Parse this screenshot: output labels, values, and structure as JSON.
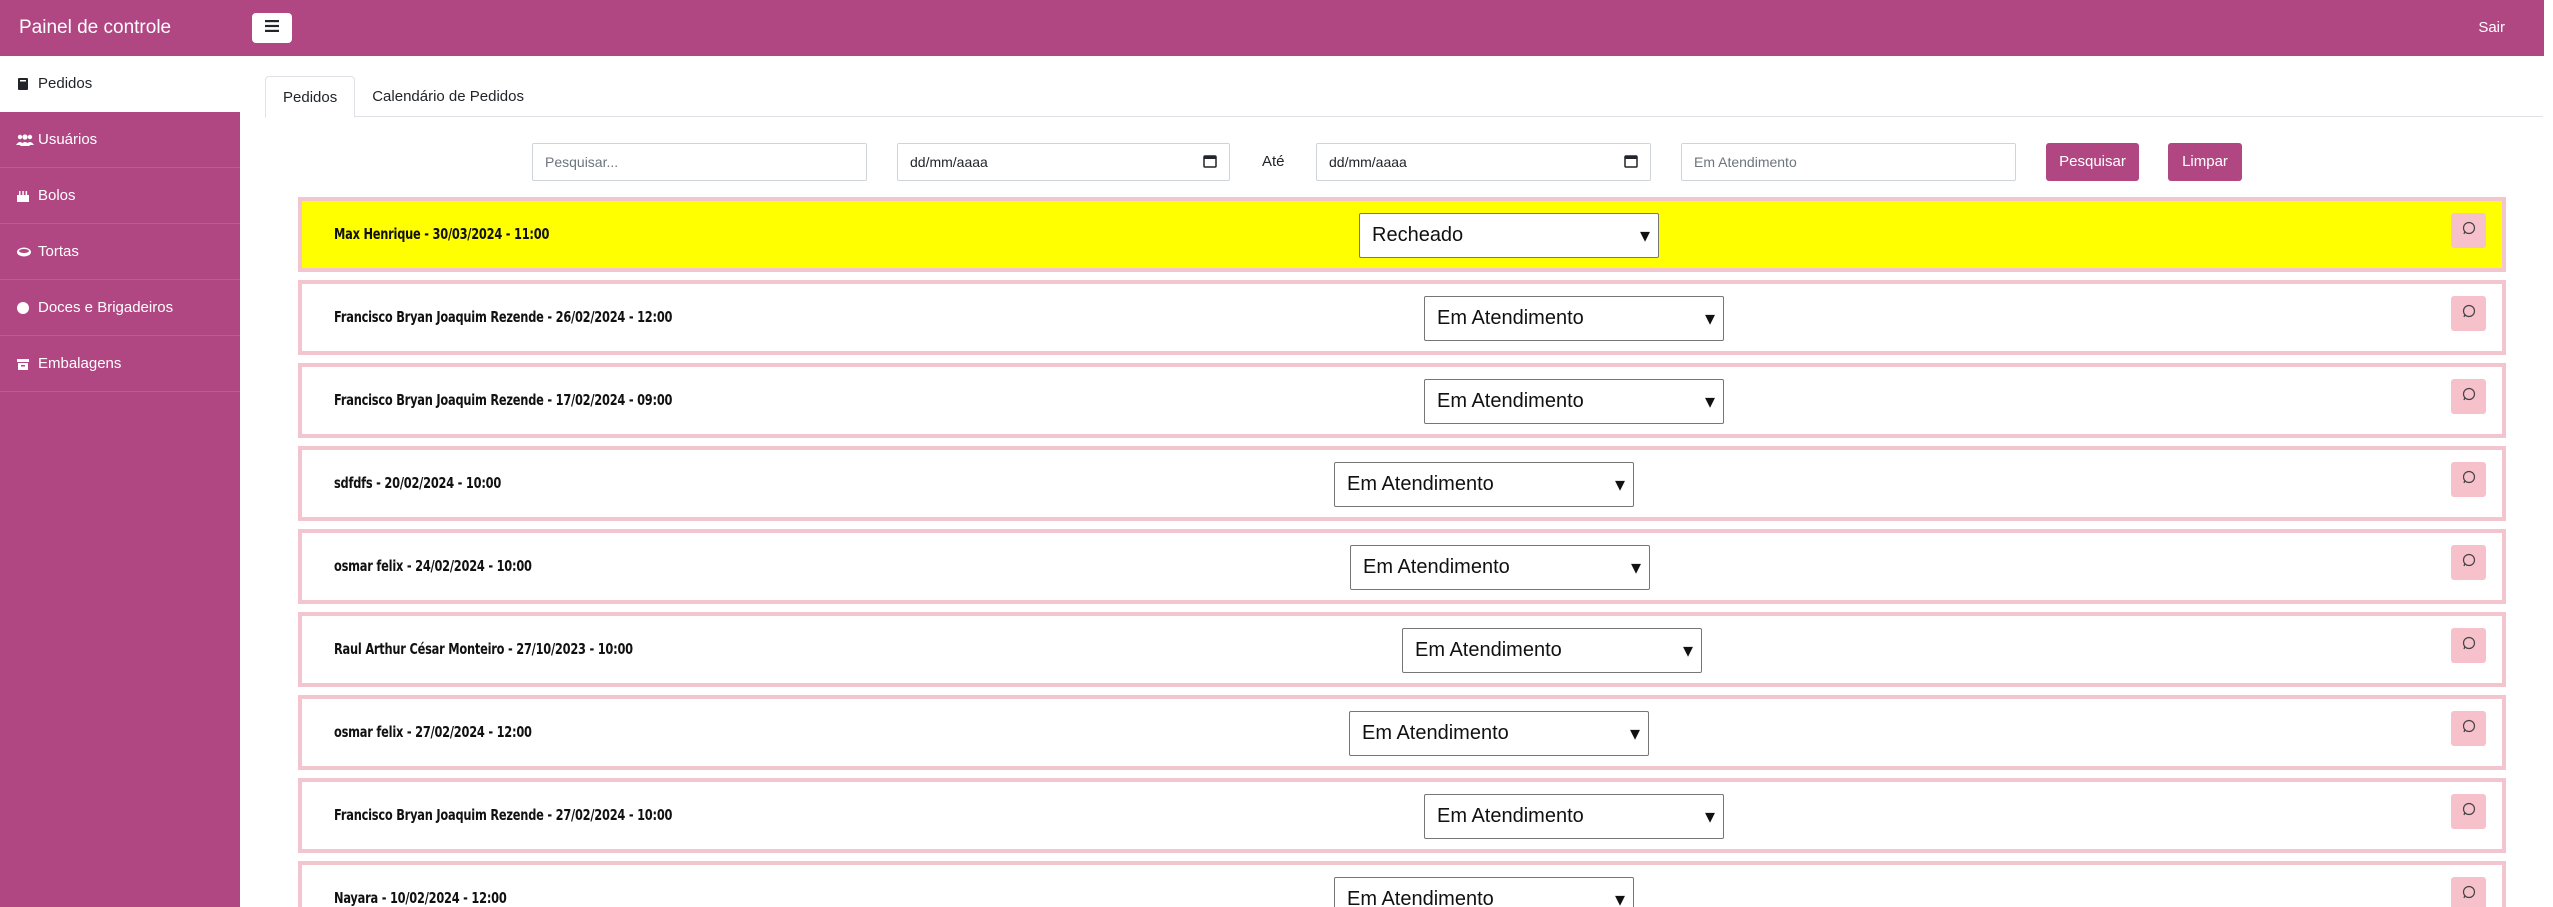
{
  "sidebar": {
    "brand": "Painel de controle",
    "items": [
      {
        "label": "Pedidos",
        "icon": "book-icon",
        "active": true
      },
      {
        "label": "Usuários",
        "icon": "users-icon",
        "active": false
      },
      {
        "label": "Bolos",
        "icon": "cake-icon",
        "active": false
      },
      {
        "label": "Tortas",
        "icon": "pie-icon",
        "active": false
      },
      {
        "label": "Doces e Brigadeiros",
        "icon": "circle-icon",
        "active": false
      },
      {
        "label": "Embalagens",
        "icon": "box-icon",
        "active": false
      }
    ]
  },
  "topbar": {
    "menu_icon": "hamburger-icon",
    "logout_label": "Sair"
  },
  "tabs": [
    {
      "label": "Pedidos",
      "active": true
    },
    {
      "label": "Calendário de Pedidos",
      "active": false
    }
  ],
  "filters": {
    "search_placeholder": "Pesquisar...",
    "date_from_placeholder": "dd/mm/aaaa",
    "until_label": "Até",
    "date_to_placeholder": "dd/mm/aaaa",
    "status_placeholder": "Em Atendimento",
    "search_button": "Pesquisar",
    "clear_button": "Limpar"
  },
  "orders": [
    {
      "title": "Max Henrique - 30/03/2024 - 11:00",
      "status": "Recheado",
      "highlight": true
    },
    {
      "title": "Francisco Bryan Joaquim Rezende - 26/02/2024 - 12:00",
      "status": "Em Atendimento",
      "highlight": false
    },
    {
      "title": "Francisco Bryan Joaquim Rezende - 17/02/2024 - 09:00",
      "status": "Em Atendimento",
      "highlight": false
    },
    {
      "title": "sdfdfs - 20/02/2024 - 10:00",
      "status": "Em Atendimento",
      "highlight": false
    },
    {
      "title": "osmar felix - 24/02/2024 - 10:00",
      "status": "Em Atendimento",
      "highlight": false
    },
    {
      "title": "Raul Arthur César Monteiro - 27/10/2023 - 10:00",
      "status": "Em Atendimento",
      "highlight": false
    },
    {
      "title": "osmar felix - 27/02/2024 - 12:00",
      "status": "Em Atendimento",
      "highlight": false
    },
    {
      "title": "Francisco Bryan Joaquim Rezende - 27/02/2024 - 10:00",
      "status": "Em Atendimento",
      "highlight": false
    },
    {
      "title": "Nayara - 10/02/2024 - 12:00",
      "status": "Em Atendimento",
      "highlight": false
    }
  ],
  "colors": {
    "brand": "#b04783",
    "highlight": "#ffff00",
    "order_border": "#f3c5cf",
    "whatsapp_button": "#f7c1cc"
  }
}
